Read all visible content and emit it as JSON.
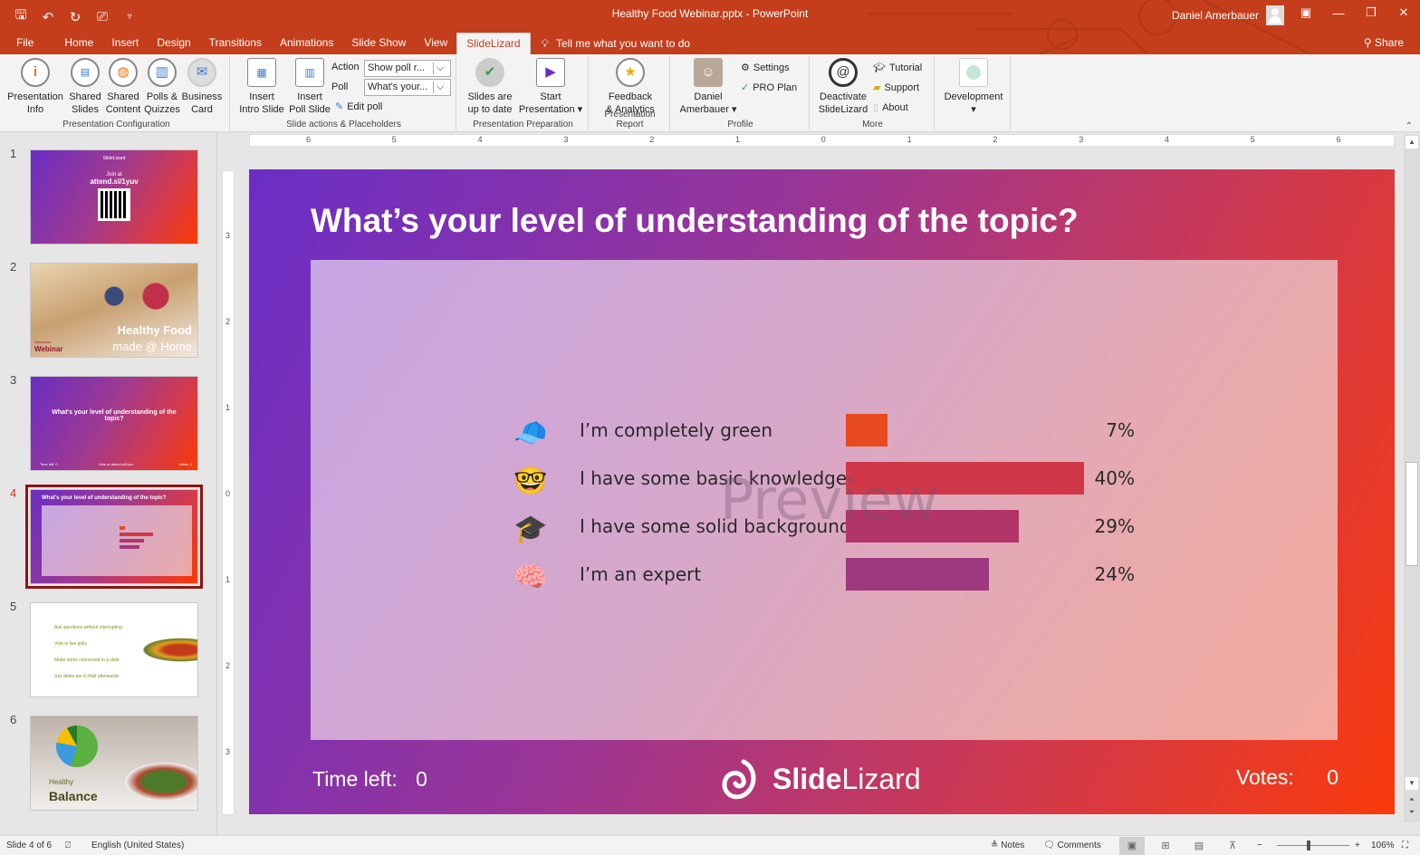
{
  "window": {
    "doc_title": "Healthy Food Webinar.pptx  -  PowerPoint",
    "user_name": "Daniel Amerbauer",
    "quick_access": [
      "save-icon",
      "undo-icon",
      "redo-icon",
      "present-icon",
      "customize-icon"
    ],
    "controls": {
      "ribbon_display": "▣",
      "minimize": "—",
      "restore": "❐",
      "close": "✕"
    },
    "share_label": "Share"
  },
  "tabs": [
    {
      "label": "File"
    },
    {
      "label": "Home"
    },
    {
      "label": "Insert"
    },
    {
      "label": "Design"
    },
    {
      "label": "Transitions"
    },
    {
      "label": "Animations"
    },
    {
      "label": "Slide Show"
    },
    {
      "label": "View"
    },
    {
      "label": "SlideLizard",
      "active": true
    }
  ],
  "tell_me": "Tell me what you want to do",
  "ribbon": {
    "groups": {
      "presentation_configuration": "Presentation Configuration",
      "slide_actions": "Slide actions & Placeholders",
      "presentation_preparation": "Presentation Preparation",
      "presentation_report": "Presentation Report",
      "profile": "Profile",
      "more": "More"
    },
    "buttons": {
      "presentation_info": [
        "Presentation",
        "Info"
      ],
      "shared_slides": [
        "Shared",
        "Slides"
      ],
      "shared_content": [
        "Shared",
        "Content"
      ],
      "polls_quizzes": [
        "Polls &",
        "Quizzes"
      ],
      "business_card": [
        "Business",
        "Card"
      ],
      "insert_intro": [
        "Insert",
        "Intro Slide"
      ],
      "insert_poll": [
        "Insert",
        "Poll Slide"
      ],
      "slides_up_to_date": [
        "Slides are",
        "up to date"
      ],
      "start_presentation": [
        "Start",
        "Presentation ▾"
      ],
      "feedback_analytics": [
        "Feedback",
        "& Analytics"
      ],
      "profile_user": [
        "Daniel",
        "Amerbauer ▾"
      ],
      "deactivate": [
        "Deactivate",
        "SlideLizard"
      ],
      "development": [
        "Development",
        "▾"
      ]
    },
    "action_label": "Action",
    "action_value": "Show poll r...",
    "poll_label": "Poll",
    "poll_value": "What's your...",
    "edit_poll": "Edit poll",
    "settings": "Settings",
    "pro_plan": "PRO Plan",
    "tutorial": "Tutorial",
    "support": "Support",
    "about": "About"
  },
  "thumbnails": [
    {
      "num": "1",
      "line1": "SlideLizard",
      "line2": "Join at",
      "line3": "attend.sl/1yuv"
    },
    {
      "num": "2",
      "title1": "Healthy Food",
      "title2": "made @ Home",
      "tag1": "Interactive",
      "tag2": "Webinar"
    },
    {
      "num": "3",
      "title": "What's your level of understanding of the topic?",
      "foot_l": "Time left: 0",
      "foot_c": "Vote at attend.sl/1yuv",
      "foot_r": "Votes: 0"
    },
    {
      "num": "4",
      "title": "What's your level of understanding of the topic?",
      "selected": true
    },
    {
      "num": "5",
      "items": [
        "Ask questions without interrupting",
        "Vote in live polls",
        "Make notes connected to a slide",
        "Get slides per E-Mail afterwards"
      ]
    },
    {
      "num": "6",
      "title1": "Healthy",
      "title2": "Balance"
    }
  ],
  "ruler": {
    "h_labels": [
      "6",
      "5",
      "4",
      "3",
      "2",
      "1",
      "0",
      "1",
      "2",
      "3",
      "4",
      "5",
      "6"
    ],
    "v_labels": [
      "3",
      "2",
      "1",
      "0",
      "1",
      "2",
      "3"
    ]
  },
  "slide": {
    "title": "What’s your level of understanding of the topic?",
    "watermark": "Preview",
    "time_left_label": "Time left:",
    "time_left_value": "0",
    "votes_label": "Votes:",
    "votes_value": "0",
    "brand_bold": "Slide",
    "brand_light": "Lizard"
  },
  "chart_data": {
    "type": "bar",
    "orientation": "horizontal",
    "categories": [
      "I’m completely green",
      "I have some basic knowledge",
      "I have some solid background",
      "I’m an expert"
    ],
    "values": [
      7,
      40,
      29,
      24
    ],
    "labels": [
      "7%",
      "40%",
      "29%",
      "24%"
    ],
    "icons": [
      "cap-icon",
      "nerd-face-icon",
      "graduation-cap-icon",
      "brain-icon"
    ],
    "emoji": [
      "🧢",
      "🤓",
      "🎓",
      "🧠"
    ],
    "colors": [
      "#e84a1f",
      "#d0384a",
      "#b23569",
      "#9d3a7f"
    ],
    "unit": "%"
  },
  "statusbar": {
    "slide_info": "Slide 4 of 6",
    "language": "English (United States)",
    "notes": "Notes",
    "comments": "Comments",
    "zoom": "106%",
    "zoom_fraction": 0.53
  }
}
